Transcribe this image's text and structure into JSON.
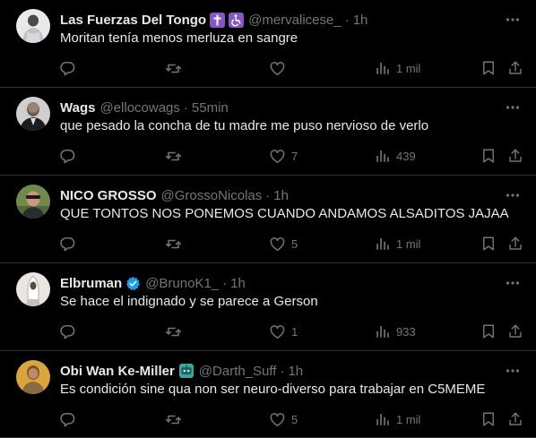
{
  "colors": {
    "background": "#000000",
    "text": "#e7e9ea",
    "muted": "#71767b",
    "divider": "#2f3336",
    "verified": "#1d9bf0"
  },
  "tweets": [
    {
      "name": "Las Fuerzas Del Tongo",
      "badges": [
        "latin-cross-emoji",
        "wheelchair-emoji"
      ],
      "handle": "@mervalicese_",
      "sep": "·",
      "time": "1h",
      "text": "Moritan tenía menos merluza en sangre",
      "replies": "",
      "retweets": "",
      "likes": "",
      "views": "1 mil"
    },
    {
      "name": "Wags",
      "badges": [],
      "handle": "@ellocowags",
      "sep": "·",
      "time": "55min",
      "text": "que pesado la concha de tu madre me puso nervioso de verlo",
      "replies": "",
      "retweets": "",
      "likes": "7",
      "views": "439"
    },
    {
      "name": "NICO GROSSO",
      "badges": [],
      "handle": "@GrossoNicolas",
      "sep": "·",
      "time": "1h",
      "text": "QUE TONTOS NOS PONEMOS CUANDO ANDAMOS ALSADITOS JAJAA",
      "replies": "",
      "retweets": "",
      "likes": "5",
      "views": "1 mil"
    },
    {
      "name": "Elbruman",
      "badges": [
        "verified-badge"
      ],
      "handle": "@BrunoK1_",
      "sep": "·",
      "time": "1h",
      "text": "Se hace el indignado y se parece a Gerson",
      "replies": "",
      "retweets": "",
      "likes": "1",
      "views": "933"
    },
    {
      "name": "Obi Wan Ke-Miller",
      "badges": [
        "robot-emoji"
      ],
      "handle": "@Darth_Suff",
      "sep": "·",
      "time": "1h",
      "text": "Es condición sine qua non ser neuro-diverso para trabajar en C5MEME",
      "replies": "",
      "retweets": "",
      "likes": "5",
      "views": "1 mil"
    }
  ]
}
